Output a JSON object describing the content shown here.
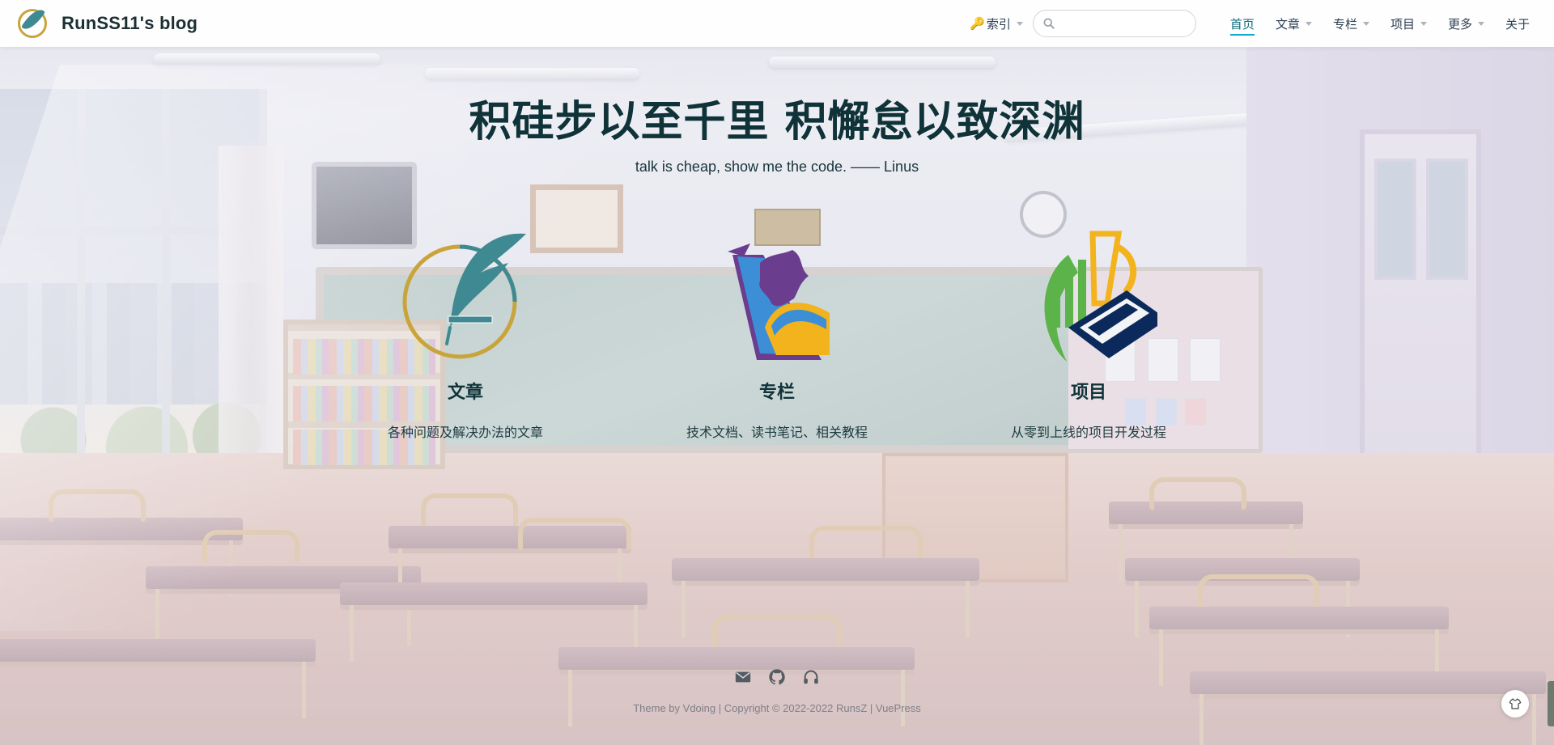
{
  "navbar": {
    "brand_title": "RunSS11's blog",
    "index_label": "索引",
    "search_placeholder": "",
    "items": [
      {
        "label": "首页",
        "active": true,
        "dropdown": false
      },
      {
        "label": "文章",
        "active": false,
        "dropdown": true
      },
      {
        "label": "专栏",
        "active": false,
        "dropdown": true
      },
      {
        "label": "项目",
        "active": false,
        "dropdown": true
      },
      {
        "label": "更多",
        "active": false,
        "dropdown": true
      },
      {
        "label": "关于",
        "active": false,
        "dropdown": false
      }
    ]
  },
  "hero": {
    "title": "积硅步以至千里 积懈怠以致深渊",
    "description": "talk is cheap, show me the code. —— Linus"
  },
  "features": [
    {
      "name": "文章",
      "desc": "各种问题及解决办法的文章",
      "icon": "quill-icon"
    },
    {
      "name": "专栏",
      "desc": "技术文档、读书笔记、相关教程",
      "icon": "book-icon"
    },
    {
      "name": "项目",
      "desc": "从零到上线的项目开发过程",
      "icon": "laptop-chart-icon"
    }
  ],
  "footer": {
    "theme_prefix": "Theme by ",
    "theme_link": "Vdoing",
    "copyright": " | Copyright © 2022-2022 ",
    "author": "RunsZ",
    "separator": " | ",
    "vuepress_link": "VuePress",
    "social_icons": [
      "mail-icon",
      "github-icon",
      "headphones-icon"
    ]
  },
  "colors": {
    "accent": "#11a8cd",
    "title": "#0f3338",
    "quill": "#3f8a92",
    "gold": "#c9a43a",
    "purple": "#6a3d8f",
    "blue": "#3c8fd6",
    "yellow": "#f2b31c",
    "green": "#5bb34a",
    "navy": "#0b2a5b"
  }
}
